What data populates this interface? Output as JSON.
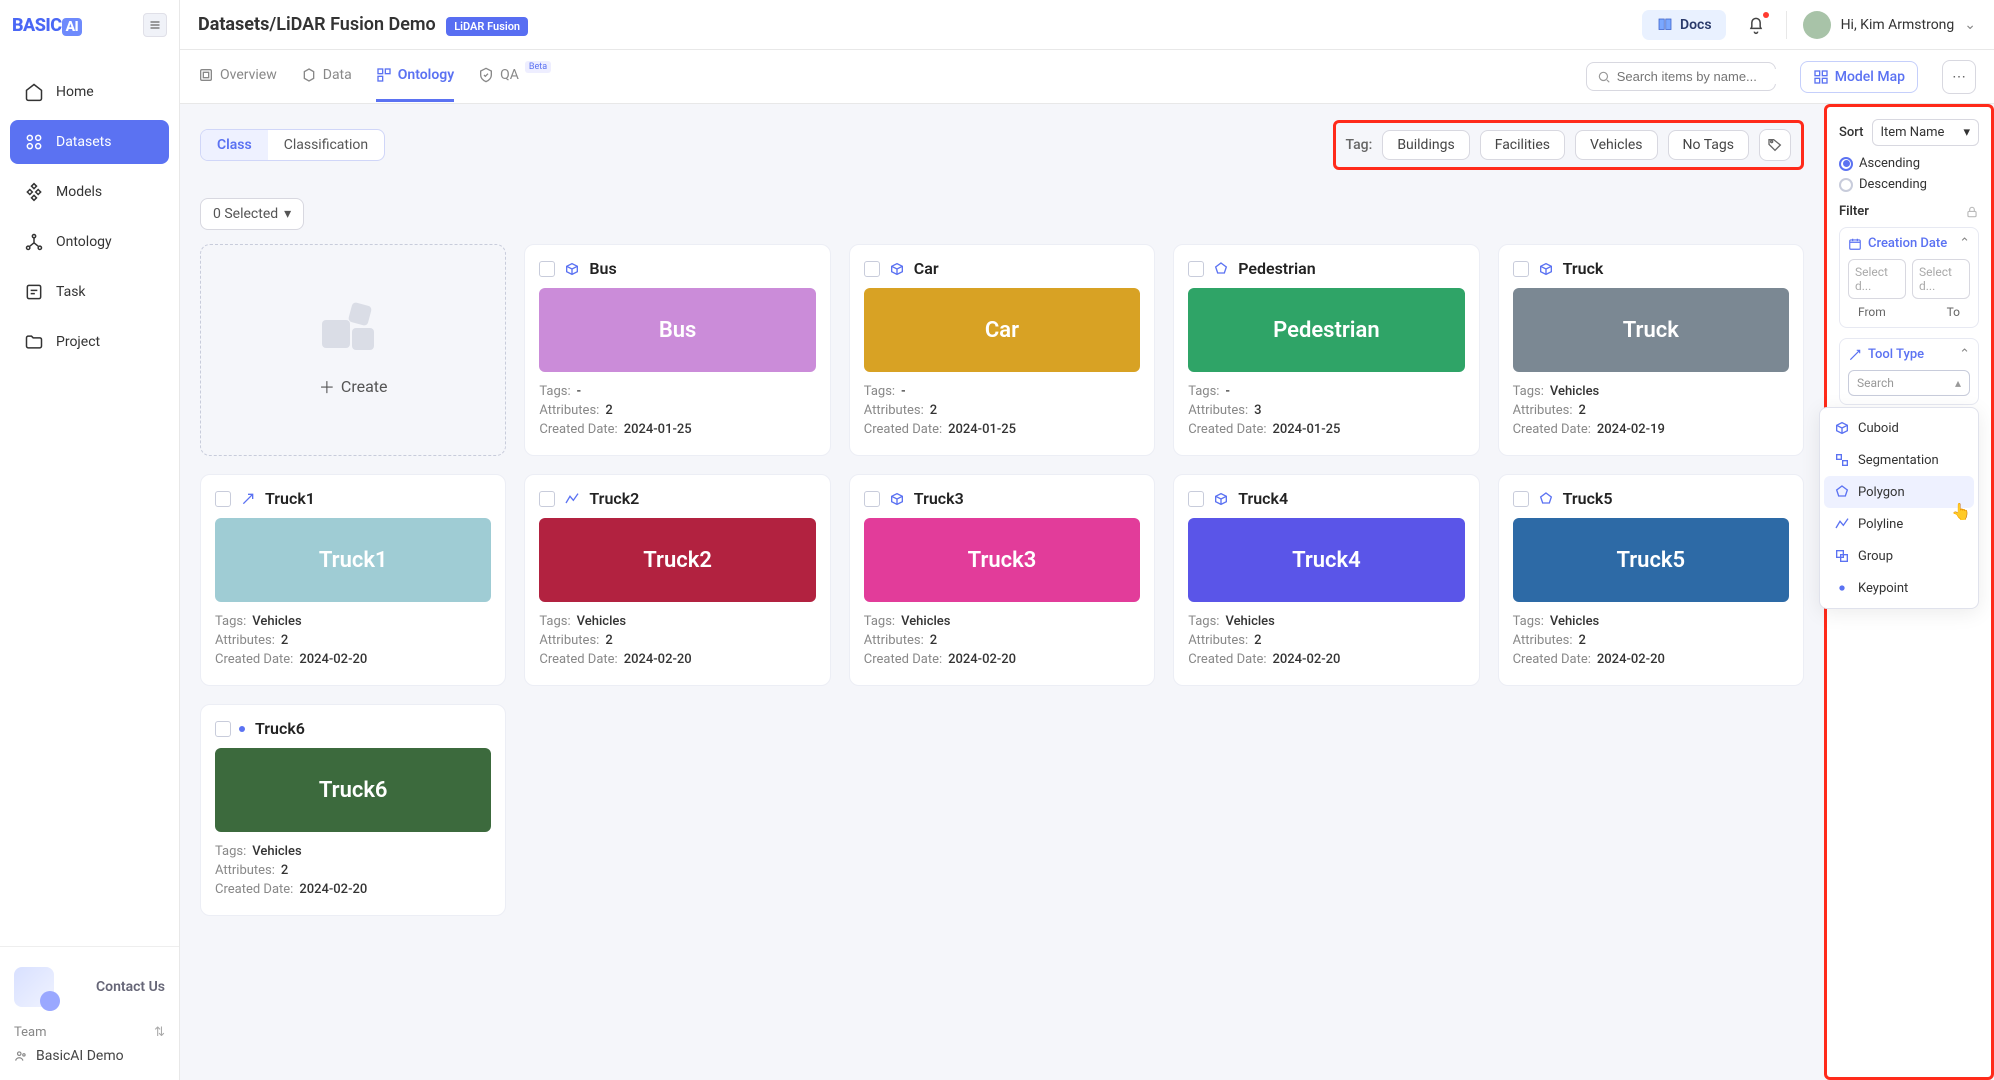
{
  "logo_text": "BASIC",
  "breadcrumb_root": "Datasets",
  "breadcrumb_leaf": "LiDAR Fusion Demo",
  "lidar_badge": "LiDAR Fusion",
  "docs_label": "Docs",
  "user_greeting": "Hi, Kim Armstrong",
  "sidebar": {
    "items": [
      {
        "label": "Home"
      },
      {
        "label": "Datasets"
      },
      {
        "label": "Models"
      },
      {
        "label": "Ontology"
      },
      {
        "label": "Task"
      },
      {
        "label": "Project"
      }
    ],
    "contact_label": "Contact Us",
    "team_label": "Team",
    "team_name": "BasicAI Demo"
  },
  "tabs": {
    "overview": "Overview",
    "data": "Data",
    "ontology": "Ontology",
    "qa": "QA",
    "qa_beta": "Beta"
  },
  "search_placeholder": "Search items by name...",
  "model_map_label": "Model Map",
  "segments": {
    "class": "Class",
    "classification": "Classification"
  },
  "selected_count": "0 Selected",
  "create_label": "Create",
  "tag_label": "Tag:",
  "tags": [
    "Buildings",
    "Facilities",
    "Vehicles",
    "No Tags"
  ],
  "meta_keys": {
    "tags": "Tags:",
    "attributes": "Attributes:",
    "created": "Created Date:"
  },
  "cards": [
    {
      "title": "Bus",
      "color": "#cb8cd9",
      "tags": "-",
      "attrs": "2",
      "date": "2024-01-25",
      "icon": "cuboid"
    },
    {
      "title": "Car",
      "color": "#d8a224",
      "tags": "-",
      "attrs": "2",
      "date": "2024-01-25",
      "icon": "cuboid"
    },
    {
      "title": "Pedestrian",
      "color": "#2fa467",
      "tags": "-",
      "attrs": "3",
      "date": "2024-01-25",
      "icon": "polygon"
    },
    {
      "title": "Truck",
      "color": "#7b8893",
      "tags": "Vehicles",
      "attrs": "2",
      "date": "2024-02-19",
      "icon": "cuboid"
    },
    {
      "title": "Truck1",
      "color": "#9fccd4",
      "tags": "Vehicles",
      "attrs": "2",
      "date": "2024-02-20",
      "icon": "arrow"
    },
    {
      "title": "Truck2",
      "color": "#b22240",
      "tags": "Vehicles",
      "attrs": "2",
      "date": "2024-02-20",
      "icon": "polyline"
    },
    {
      "title": "Truck3",
      "color": "#e23c9a",
      "tags": "Vehicles",
      "attrs": "2",
      "date": "2024-02-20",
      "icon": "cuboid"
    },
    {
      "title": "Truck4",
      "color": "#5a55e8",
      "tags": "Vehicles",
      "attrs": "2",
      "date": "2024-02-20",
      "icon": "cuboid"
    },
    {
      "title": "Truck5",
      "color": "#2d6aa6",
      "tags": "Vehicles",
      "attrs": "2",
      "date": "2024-02-20",
      "icon": "polygon"
    },
    {
      "title": "Truck6",
      "color": "#3c6a3d",
      "tags": "Vehicles",
      "attrs": "2",
      "date": "2024-02-20",
      "icon": "keypoint"
    }
  ],
  "right": {
    "sort_label": "Sort",
    "sort_value": "Item Name",
    "asc": "Ascending",
    "desc": "Descending",
    "filter_label": "Filter",
    "creation_date": "Creation Date",
    "from": "From",
    "to": "To",
    "date_ph": "Select d...",
    "tool_type": "Tool Type",
    "tool_search_ph": "Search",
    "tool_options": [
      {
        "label": "Cuboid",
        "icon": "cuboid"
      },
      {
        "label": "Segmentation",
        "icon": "seg"
      },
      {
        "label": "Polygon",
        "icon": "polygon"
      },
      {
        "label": "Polyline",
        "icon": "polyline"
      },
      {
        "label": "Group",
        "icon": "group"
      },
      {
        "label": "Keypoint",
        "icon": "keypoint"
      }
    ]
  }
}
